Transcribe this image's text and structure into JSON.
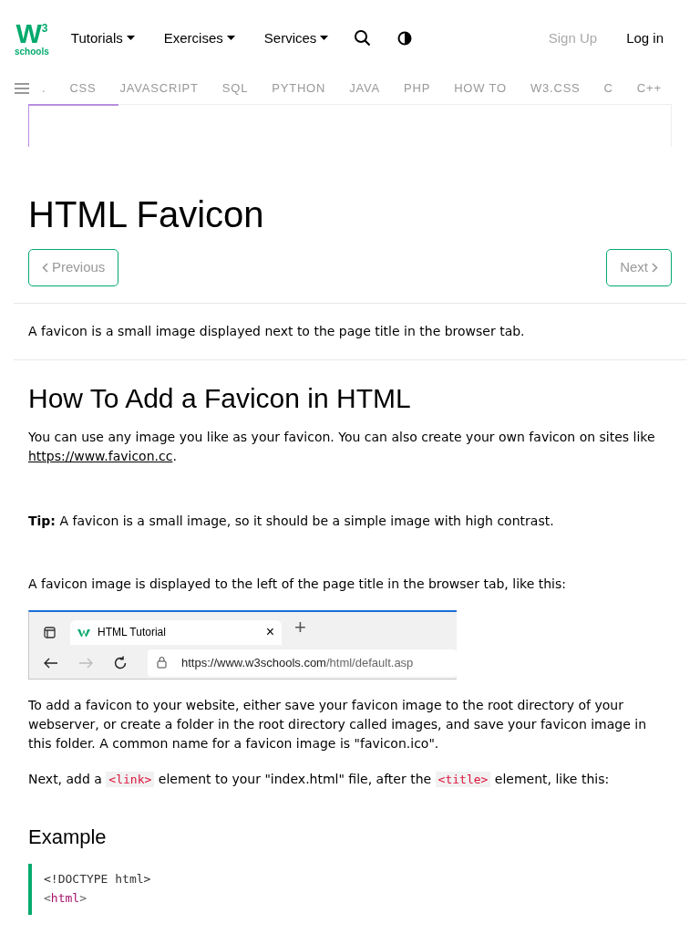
{
  "logo": {
    "letter": "W",
    "sup": "3",
    "text": "schools"
  },
  "nav": [
    {
      "label": "Tutorials",
      "dropdown": true
    },
    {
      "label": "Exercises",
      "dropdown": true
    },
    {
      "label": "Services",
      "dropdown": true
    }
  ],
  "account": [
    {
      "label": "Sign Up",
      "kind": "muted"
    },
    {
      "label": "Log in",
      "kind": "plain"
    }
  ],
  "subnav": [
    ".",
    "CSS",
    "JAVASCRIPT",
    "SQL",
    "PYTHON",
    "JAVA",
    "PHP",
    "HOW TO",
    "W3.CSS",
    "C",
    "C++"
  ],
  "ad": {
    "level": 0.14
  },
  "title": "HTML Favicon",
  "pager": [
    {
      "label": "Previous",
      "kind": "prev"
    },
    {
      "label": "Next",
      "kind": "next"
    }
  ],
  "intro": "A favicon is a small image displayed next to the page title in the browser tab.",
  "heading": "How To Add a Favicon in HTML",
  "blocks": [
    {
      "kind": "para",
      "parts": [
        {
          "kind": "text",
          "text": "You can use any image you like as your favicon. You can also create your own favicon on sites like "
        },
        {
          "kind": "link",
          "text": "https://www.favicon.cc"
        },
        {
          "kind": "text",
          "text": "."
        }
      ]
    },
    {
      "kind": "tip",
      "text": "**Tip:** A favicon is a small image, so it should be a simple image with high contrast."
    },
    {
      "kind": "para",
      "parts": [
        {
          "kind": "text",
          "text": "A favicon image is displayed to the left of the page title in the browser tab, like this:"
        }
      ]
    },
    {
      "kind": "browser",
      "tab": "HTML Tutorial",
      "close": "×",
      "newtab": "+",
      "url_host": "https://www.w3schools.com",
      "url_path": "/html/default.asp"
    },
    {
      "kind": "para",
      "parts": [
        {
          "kind": "text",
          "text": "To add a favicon to your website, either save your favicon image to the root directory of your webserver, or create a folder in the root directory called images, and save your favicon image in this folder. A common name for a favicon image is \"favicon.ico\"."
        }
      ]
    },
    {
      "kind": "para",
      "parts": [
        {
          "kind": "text",
          "text": "Next, add a "
        },
        {
          "kind": "code",
          "text": "<link>"
        },
        {
          "kind": "text",
          "text": " element to your \"index.html\" file, after the "
        },
        {
          "kind": "code",
          "text": "<title>"
        },
        {
          "kind": "text",
          "text": " element, like this:"
        }
      ]
    }
  ],
  "example": {
    "title": "Example",
    "lines": [
      [
        {
          "kind": "plain",
          "text": "<!DOCTYPE html>"
        }
      ],
      [
        {
          "kind": "punct",
          "text": "<"
        },
        {
          "kind": "tag",
          "text": "html"
        },
        {
          "kind": "punct",
          "text": ">"
        }
      ]
    ]
  }
}
